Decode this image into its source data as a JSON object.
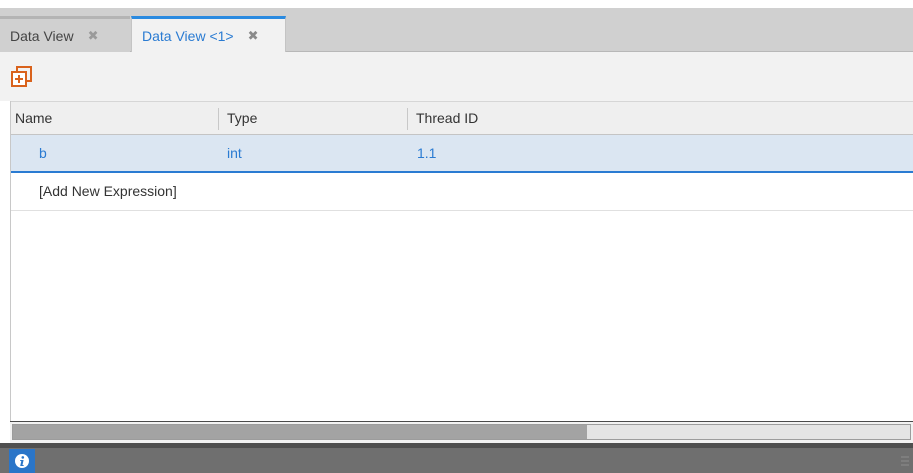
{
  "tabs": [
    {
      "label": "Data View",
      "active": false,
      "close_glyph": "✖"
    },
    {
      "label": "Data View <1>",
      "active": true,
      "close_glyph": "✖"
    }
  ],
  "toolbar": {
    "add_expression_icon": "add-expression-icon"
  },
  "table": {
    "columns": [
      "Name",
      "Type",
      "Thread ID"
    ],
    "rows": [
      {
        "name": "b",
        "type": "int",
        "thread_id": "1.1",
        "selected": true
      }
    ],
    "add_row_label": "[Add New Expression]"
  },
  "scrollbar": {
    "thumb_fraction": 0.64
  },
  "colors": {
    "accent": "#2a7bd2",
    "selected_row_bg": "#dbe6f2",
    "toolbar_icon": "#d9621c",
    "status_bar": "#6f6f6f"
  },
  "status": {
    "info_icon": "info-icon"
  }
}
